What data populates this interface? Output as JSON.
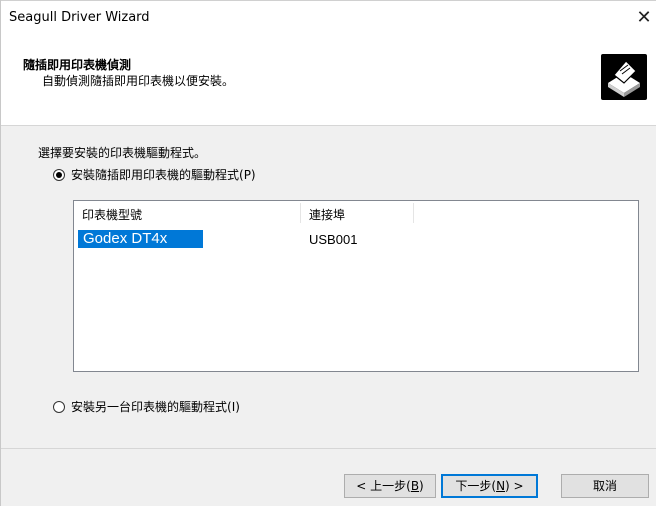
{
  "window": {
    "title": "Seagull Driver Wizard",
    "close_glyph": "✕"
  },
  "header": {
    "title": "隨插即用印表機偵測",
    "subtitle": "自動偵測隨插即用印表機以便安裝。",
    "icon": "printer-icon"
  },
  "main": {
    "prompt": "選擇要安裝的印表機驅動程式。",
    "option_pnp": {
      "label": "安裝隨插即用印表機的驅動程式",
      "accel": "(P)",
      "checked": true
    },
    "list": {
      "columns": [
        "印表機型號",
        "連接埠"
      ],
      "rows": [
        {
          "model": "Godex DT4x",
          "port": "USB001",
          "selected": true
        }
      ]
    },
    "option_other": {
      "label": "安裝另一台印表機的驅動程式",
      "accel": "(I)",
      "checked": false
    }
  },
  "footer": {
    "back_prefix": "< 上一步(",
    "back_key": "B",
    "back_suffix": ")",
    "next_prefix": "下一步(",
    "next_key": "N",
    "next_suffix": ") >",
    "cancel": "取消"
  }
}
